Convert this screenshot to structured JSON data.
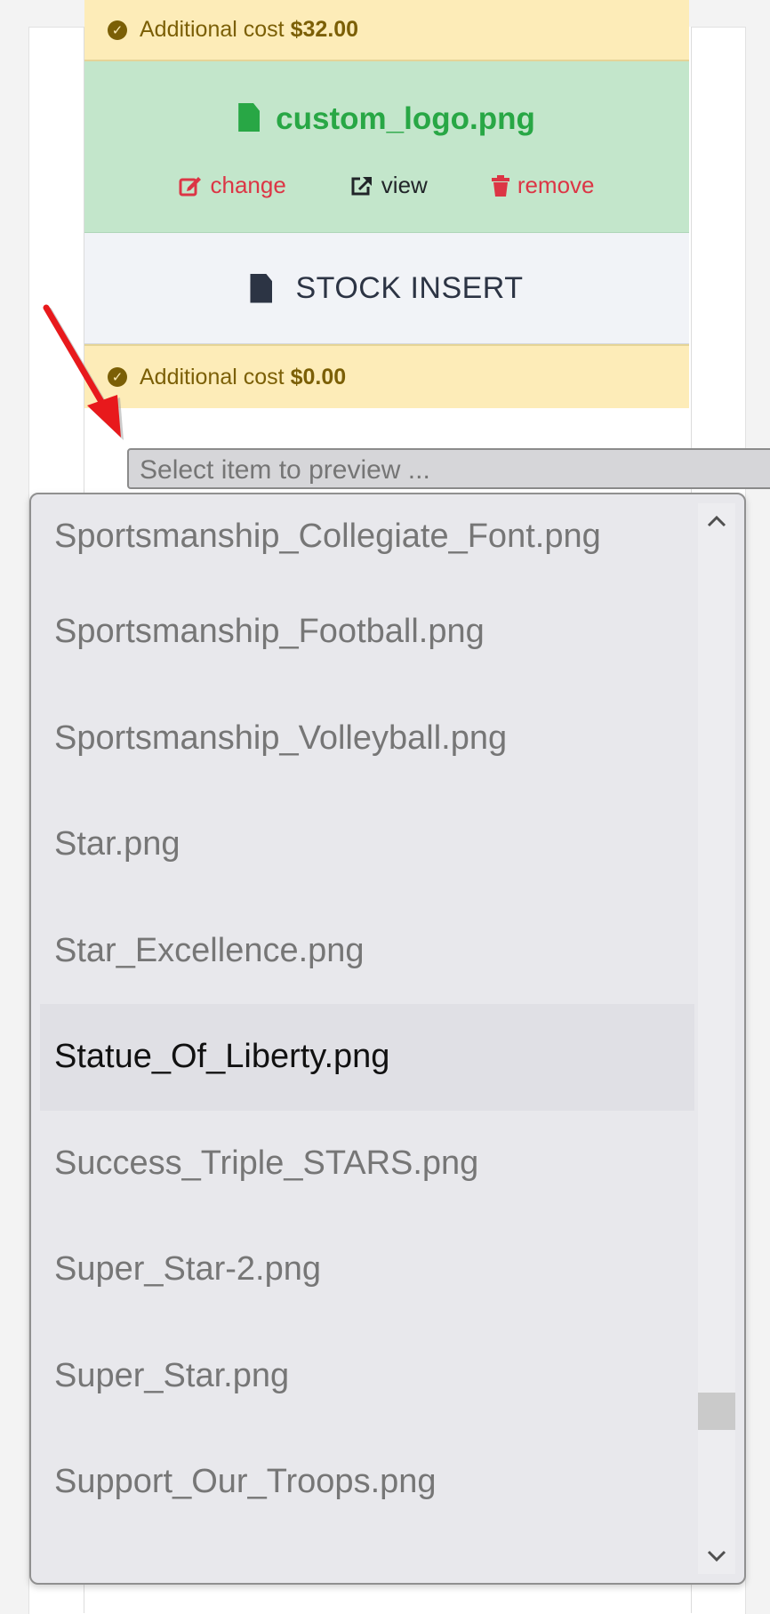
{
  "cost_top": {
    "label": "Additional cost",
    "amount": "$32.00"
  },
  "upload": {
    "filename": "custom_logo.png",
    "actions": {
      "change": "change",
      "view": "view",
      "remove": "remove"
    }
  },
  "stock_insert": {
    "label": "STOCK INSERT"
  },
  "cost_bottom": {
    "label": "Additional cost",
    "amount": "$0.00"
  },
  "select": {
    "placeholder": "Select item to preview ..."
  },
  "dropdown": {
    "options": [
      "Sportsmanship_Collegiate_Font.png",
      "Sportsmanship_Football.png",
      "Sportsmanship_Volleyball.png",
      "Star.png",
      "Star_Excellence.png",
      "Statue_Of_Liberty.png",
      "Success_Triple_STARS.png",
      "Super_Star-2.png",
      "Super_Star.png",
      "Support_Our_Troops.png"
    ],
    "highlighted": "Statue_Of_Liberty.png"
  },
  "colors": {
    "success": "#28a745",
    "danger": "#dc3545",
    "warning_bg": "#fdecb8",
    "warning_text": "#7b5f06",
    "annotation_arrow": "#e8191c"
  }
}
